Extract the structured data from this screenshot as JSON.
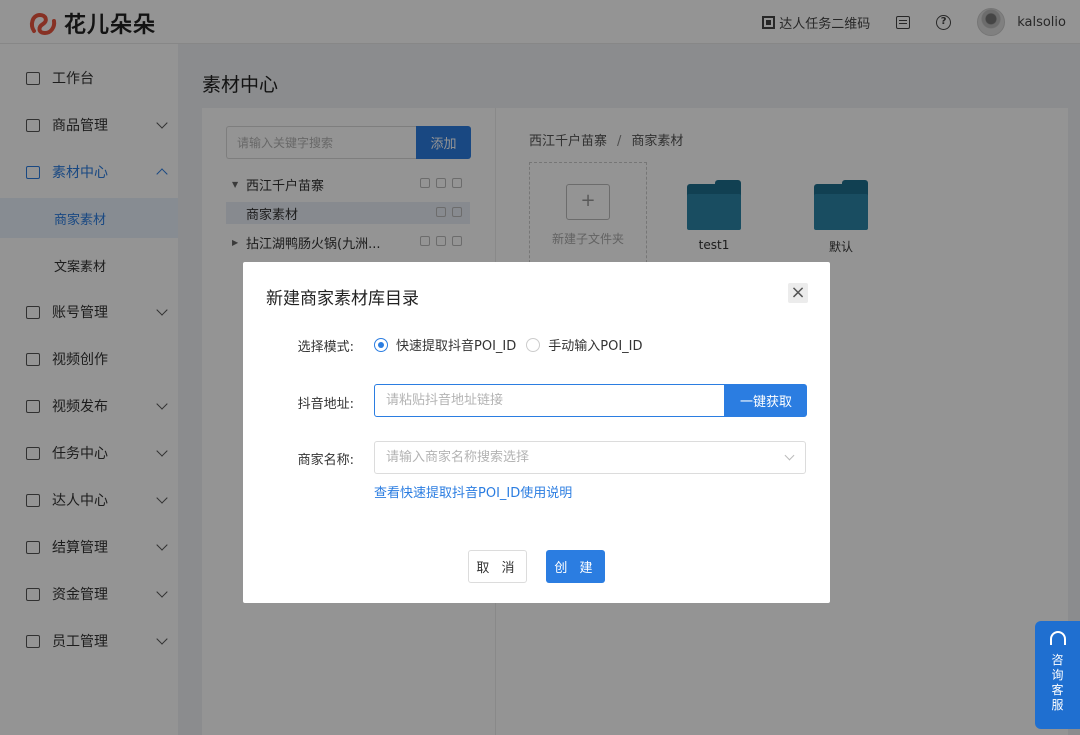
{
  "header": {
    "logo_text": "花儿朵朵",
    "qr_label": "达人任务二维码",
    "username": "kalsolio"
  },
  "sidebar": {
    "items": [
      {
        "label": "工作台"
      },
      {
        "label": "商品管理"
      },
      {
        "label": "素材中心"
      },
      {
        "label": "商家素材"
      },
      {
        "label": "文案素材"
      },
      {
        "label": "账号管理"
      },
      {
        "label": "视频创作"
      },
      {
        "label": "视频发布"
      },
      {
        "label": "任务中心"
      },
      {
        "label": "达人中心"
      },
      {
        "label": "结算管理"
      },
      {
        "label": "资金管理"
      },
      {
        "label": "员工管理"
      }
    ]
  },
  "main": {
    "page_title": "素材中心",
    "search_placeholder": "请输入关键字搜索",
    "add_label": "添加",
    "tree": [
      {
        "label": "西江千户苗寨"
      },
      {
        "label": "商家素材"
      },
      {
        "label": "拈江湖鸭肠火锅(九洲..."
      }
    ],
    "breadcrumb": {
      "root": "西江千户苗寨",
      "sep": "/",
      "current": "商家素材"
    },
    "new_folder_label": "新建子文件夹",
    "folders": [
      {
        "label": "test1"
      },
      {
        "label": "默认"
      }
    ]
  },
  "dialog": {
    "title": "新建商家素材库目录",
    "close": "×",
    "mode_label": "选择模式:",
    "mode_options": [
      {
        "label": "快速提取抖音POI_ID",
        "selected": true
      },
      {
        "label": "手动输入POI_ID",
        "selected": false
      }
    ],
    "url_label": "抖音地址:",
    "url_placeholder": "请粘贴抖音地址链接",
    "fetch_label": "一键获取",
    "merchant_label": "商家名称:",
    "merchant_placeholder": "请输入商家名称搜索选择",
    "help_link": "查看快速提取抖音POI_ID使用说明",
    "cancel_label": "取 消",
    "create_label": "创 建"
  },
  "consult": {
    "label": "咨询客服"
  },
  "colors": {
    "primary": "#2b7de1",
    "folder": "#2b86a8"
  }
}
